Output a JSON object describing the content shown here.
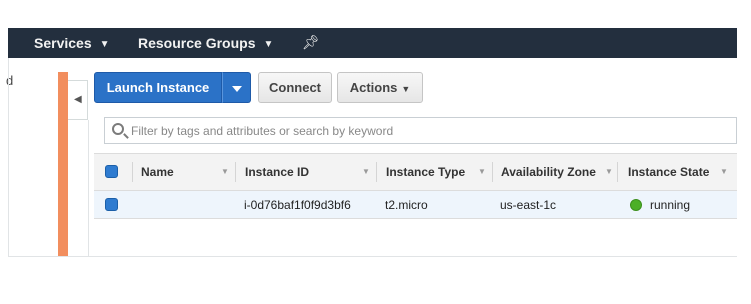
{
  "nav": {
    "services": "Services",
    "resource_groups": "Resource Groups",
    "chevron": "⌄",
    "pin_icon": "pin-icon"
  },
  "left": {
    "fragment": "d"
  },
  "toolbar": {
    "launch_label": "Launch Instance",
    "connect_label": "Connect",
    "actions_label": "Actions",
    "actions_chevron": "⌄"
  },
  "search": {
    "placeholder": "Filter by tags and attributes or search by keyword",
    "value": ""
  },
  "table": {
    "columns": [
      "Name",
      "Instance ID",
      "Instance Type",
      "Availability Zone",
      "Instance State"
    ],
    "rows": [
      {
        "name": "",
        "instance_id": "i-0d76baf1f0f9d3bf6",
        "instance_type": "t2.micro",
        "availability_zone": "us-east-1c",
        "instance_state": "running",
        "state_color": "#4caf26"
      }
    ]
  },
  "colors": {
    "nav_bg": "#232f3e",
    "primary": "#2b72c7",
    "accent_bar": "#f28e5e",
    "row_selected": "#eef5fc"
  }
}
